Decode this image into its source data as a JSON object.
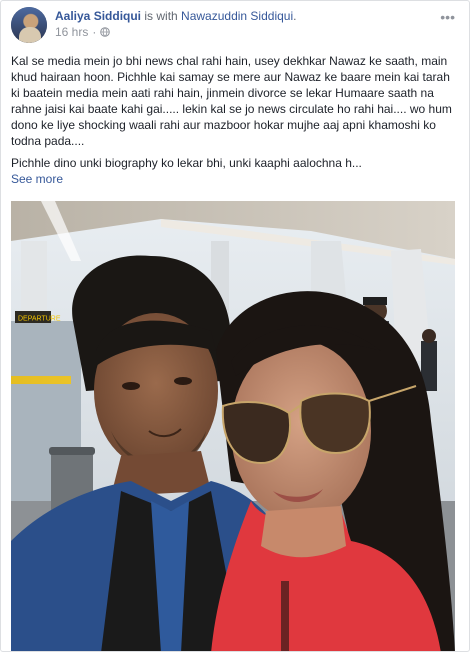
{
  "post": {
    "author": "Aaliya Siddiqui",
    "with_text": "is with",
    "tagged_person": "Nawazuddin Siddiqui",
    "tagged_suffix": ".",
    "timestamp": "16 hrs",
    "privacy_icon": "globe-icon",
    "menu_icon": "more-options-icon",
    "paragraph_1": "Kal se media mein jo bhi news chal rahi hain, usey dekhkar Nawaz ke saath, main khud hairaan hoon. Pichhle kai samay se mere aur Nawaz ke baare mein kai tarah ki baatein media mein aati rahi hain, jinmein divorce se lekar Humaare saath na rahne jaisi kai baate kahi gai..... lekin kal se jo news circulate ho rahi hai.... wo hum dono ke liye shocking waali rahi aur mazboor hokar mujhe aaj apni khamoshi ko todna pada....",
    "paragraph_2": "Pichhle dino unki biography ko lekar bhi, unki kaaphi aalochna h...",
    "see_more": "See more"
  },
  "photo": {
    "sign_text": "DEPARTURE"
  },
  "colors": {
    "link": "#365899",
    "meta": "#90949c",
    "text": "#1d2129",
    "border": "#dddfe2"
  }
}
